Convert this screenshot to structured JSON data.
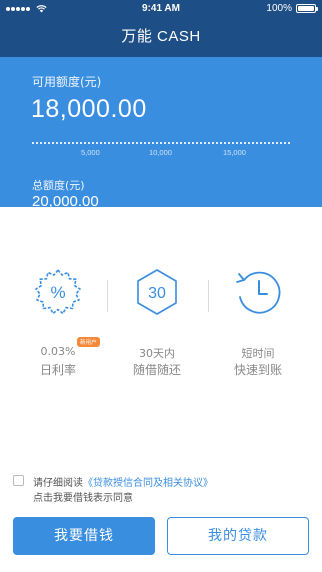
{
  "status_bar": {
    "time": "9:41 AM",
    "battery": "100%"
  },
  "header": {
    "title": "万能 CASH"
  },
  "credit": {
    "available_label": "可用额度(元)",
    "available_value": "18,000.00",
    "scale_ticks": [
      "5,000",
      "10,000",
      "15,000"
    ],
    "total_label": "总额度(元)",
    "total_value": "20,000.00"
  },
  "features": [
    {
      "icon": "percent-badge-icon",
      "line1": "0.03%",
      "line2": "日利率",
      "badge": "新用户"
    },
    {
      "icon": "hexagon-30-icon",
      "icon_text": "30",
      "line1": "30天内",
      "line2": "随借随还"
    },
    {
      "icon": "clock-history-icon",
      "line1": "短时间",
      "line2": "快速到账"
    }
  ],
  "agreement": {
    "prefix": "请仔细阅读",
    "link": "《贷款授信合同及相关协议》",
    "note": "点击我要借钱表示同意"
  },
  "actions": {
    "borrow_label": "我要借钱",
    "loans_label": "我的贷款"
  },
  "colors": {
    "nav_bg": "#1e4e86",
    "accent": "#3a8ee0",
    "badge": "#f5893a"
  }
}
